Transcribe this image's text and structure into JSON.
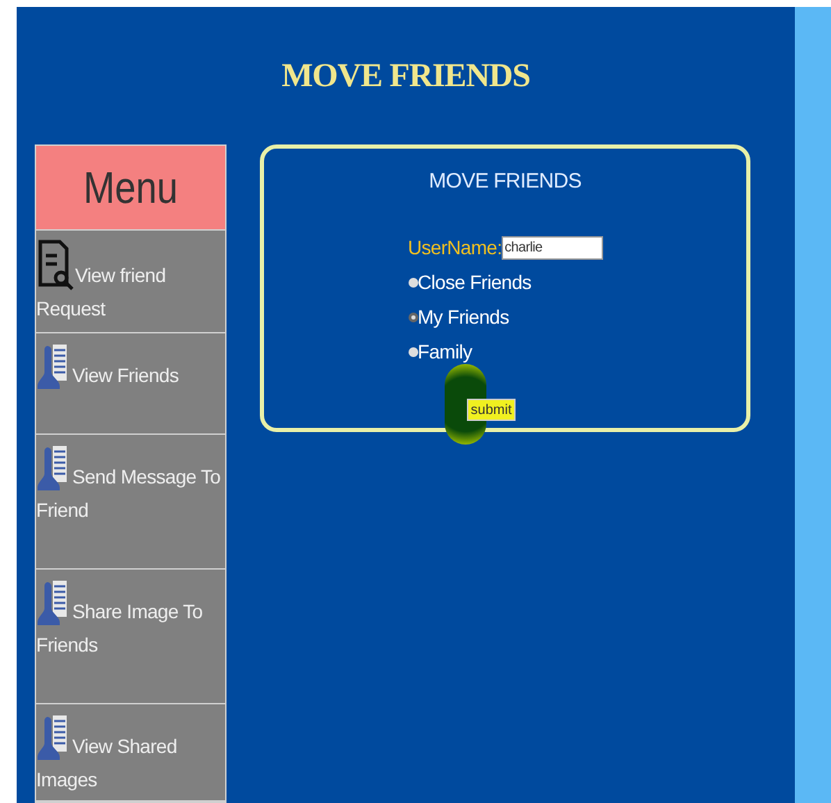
{
  "header": {
    "title": "MOVE FRIENDS"
  },
  "sidebar": {
    "title": "Menu",
    "items": [
      {
        "label": "View friend Request",
        "kind": "request"
      },
      {
        "label": "View Friends",
        "kind": "person"
      },
      {
        "label": "Send Message To Friend",
        "kind": "person"
      },
      {
        "label": "Share Image To Friends",
        "kind": "person"
      },
      {
        "label": "View Shared Images",
        "kind": "person"
      }
    ]
  },
  "form": {
    "title": "MOVE FRIENDS",
    "username_label": "UserName:",
    "username_value": "charlie",
    "options": [
      {
        "label": "Close Friends",
        "selected": false
      },
      {
        "label": "My Friends",
        "selected": true
      },
      {
        "label": "Family",
        "selected": false
      }
    ],
    "submit": "submit"
  }
}
